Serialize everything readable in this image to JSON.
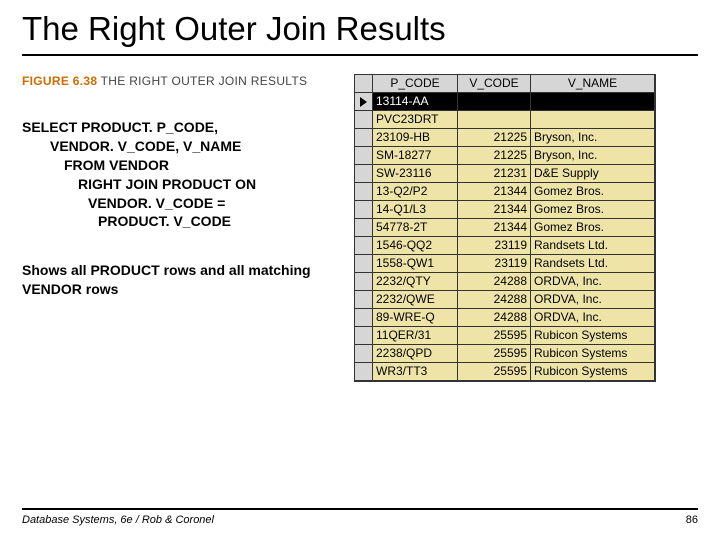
{
  "title": "The Right Outer Join Results",
  "figure": {
    "label": "FIGURE 6.38",
    "caption": "The Right Outer Join Results"
  },
  "sql": {
    "l1": "SELECT PRODUCT. P_CODE,",
    "l2": "VENDOR. V_CODE, V_NAME",
    "l3": "FROM VENDOR",
    "l4": "RIGHT JOIN PRODUCT ON",
    "l5": "VENDOR. V_CODE =",
    "l6": "PRODUCT. V_CODE"
  },
  "description": "Shows all PRODUCT rows and all matching VENDOR rows",
  "table": {
    "headers": {
      "p": "P_CODE",
      "vc": "V_CODE",
      "vn": "V_NAME"
    },
    "rows": [
      {
        "p": "13114-AA",
        "vc": "",
        "vn": "",
        "selected": true
      },
      {
        "p": "PVC23DRT",
        "vc": "",
        "vn": ""
      },
      {
        "p": "23109-HB",
        "vc": "21225",
        "vn": "Bryson, Inc."
      },
      {
        "p": "SM-18277",
        "vc": "21225",
        "vn": "Bryson, Inc."
      },
      {
        "p": "SW-23116",
        "vc": "21231",
        "vn": "D&E Supply"
      },
      {
        "p": "13-Q2/P2",
        "vc": "21344",
        "vn": "Gomez Bros."
      },
      {
        "p": "14-Q1/L3",
        "vc": "21344",
        "vn": "Gomez Bros."
      },
      {
        "p": "54778-2T",
        "vc": "21344",
        "vn": "Gomez Bros."
      },
      {
        "p": "1546-QQ2",
        "vc": "23119",
        "vn": "Randsets Ltd."
      },
      {
        "p": "1558-QW1",
        "vc": "23119",
        "vn": "Randsets Ltd."
      },
      {
        "p": "2232/QTY",
        "vc": "24288",
        "vn": "ORDVA, Inc."
      },
      {
        "p": "2232/QWE",
        "vc": "24288",
        "vn": "ORDVA, Inc."
      },
      {
        "p": "89-WRE-Q",
        "vc": "24288",
        "vn": "ORDVA, Inc."
      },
      {
        "p": "11QER/31",
        "vc": "25595",
        "vn": "Rubicon Systems"
      },
      {
        "p": "2238/QPD",
        "vc": "25595",
        "vn": "Rubicon Systems"
      },
      {
        "p": "WR3/TT3",
        "vc": "25595",
        "vn": "Rubicon Systems"
      }
    ]
  },
  "footer": {
    "source": "Database Systems, 6e / Rob & Coronel",
    "page": "86"
  }
}
